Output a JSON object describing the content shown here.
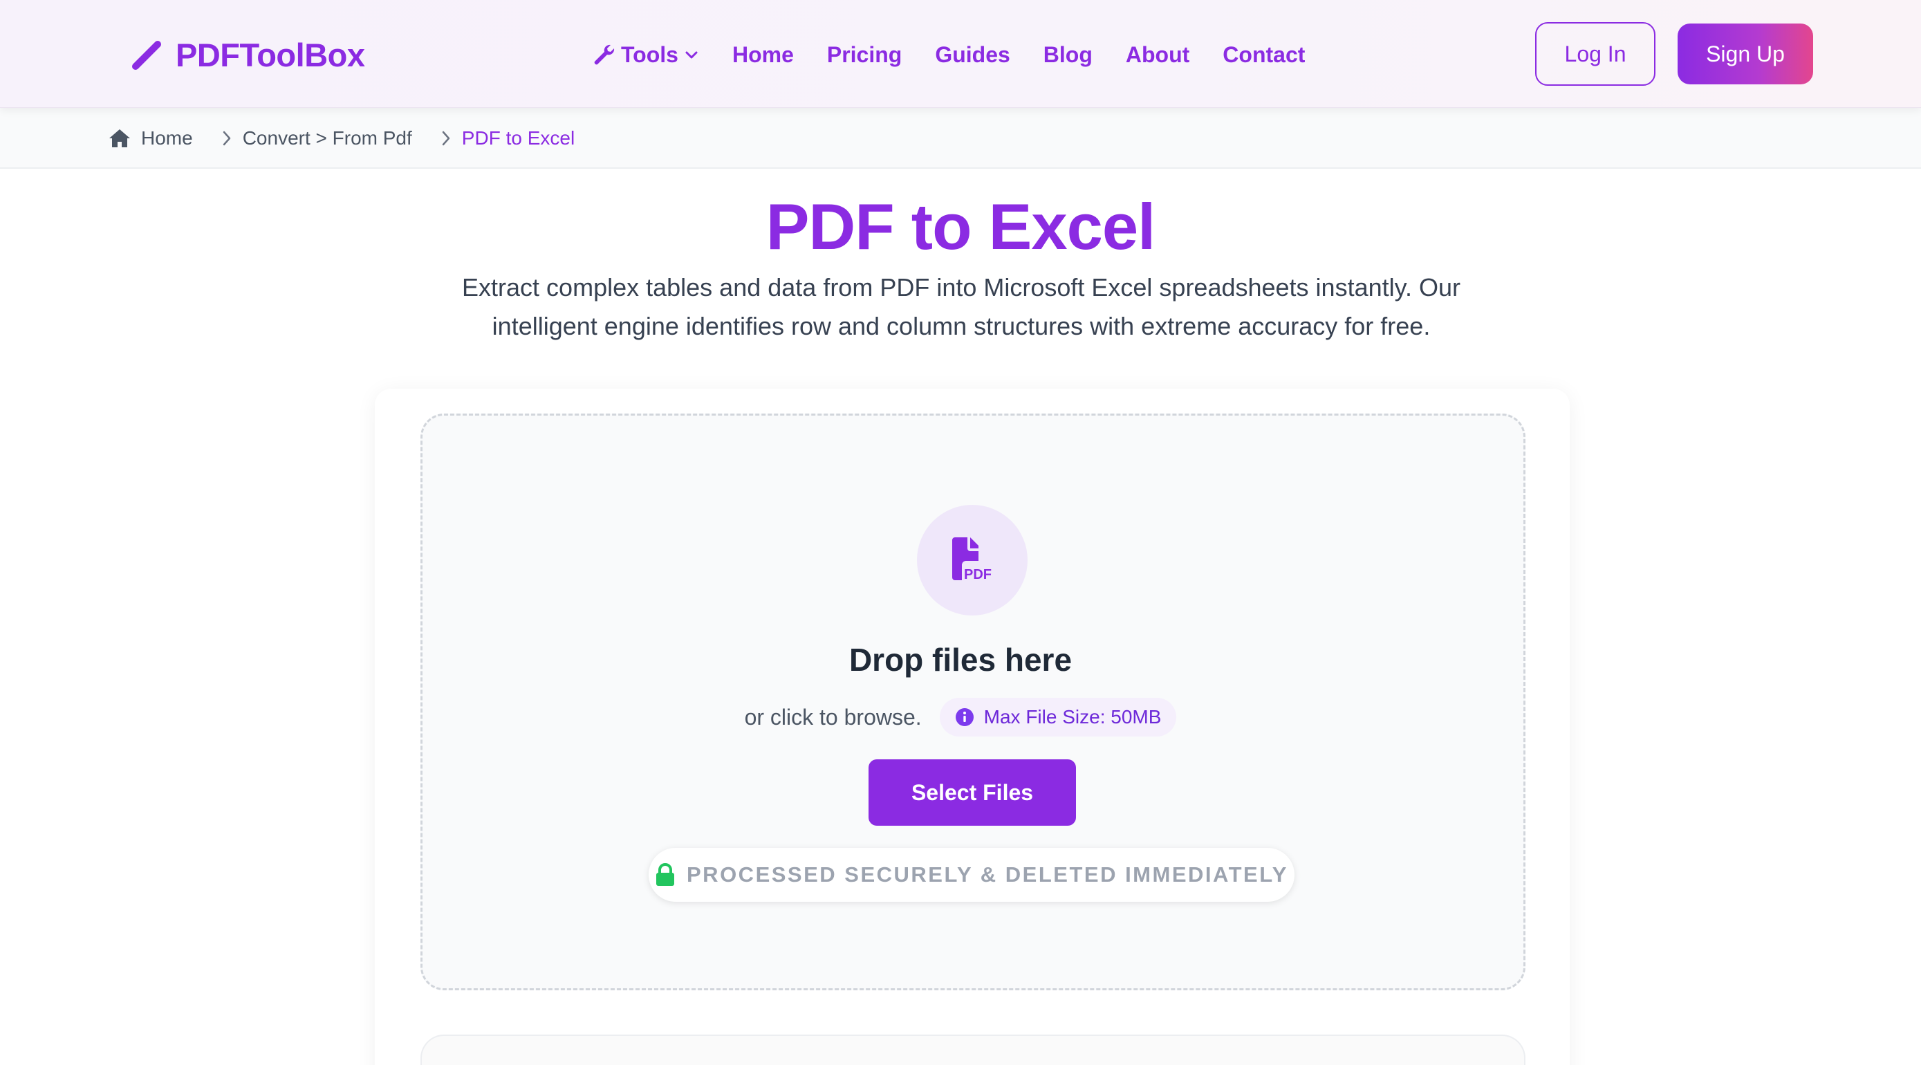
{
  "brand": {
    "name": "PDFToolBox",
    "accent": "#8b2be2",
    "accent_end": "#e3468e"
  },
  "nav": {
    "tools": {
      "label": "Tools",
      "icon": "wrench-icon",
      "caret": "chevron-down-icon"
    },
    "items": [
      "Home",
      "Pricing",
      "Guides",
      "Blog",
      "About",
      "Contact"
    ]
  },
  "auth": {
    "login": "Log In",
    "signup": "Sign Up"
  },
  "breadcrumb": {
    "home": "Home",
    "middle": "Convert > From Pdf",
    "current": "PDF to Excel"
  },
  "hero": {
    "title": "PDF to Excel",
    "description": "Extract complex tables and data from PDF into Microsoft Excel spreadsheets instantly. Our intelligent engine identifies row and column structures with extreme accuracy for free."
  },
  "upload": {
    "file_icon_label": "PDF",
    "drop_title": "Drop files here",
    "browse_text": "or click to browse.",
    "max_size": "Max File Size: 50MB",
    "select_button": "Select Files",
    "secure_note": "PROCESSED SECURELY & DELETED IMMEDIATELY"
  },
  "colors": {
    "secure_lock": "#22c55e",
    "text_muted": "#9ca3af"
  }
}
